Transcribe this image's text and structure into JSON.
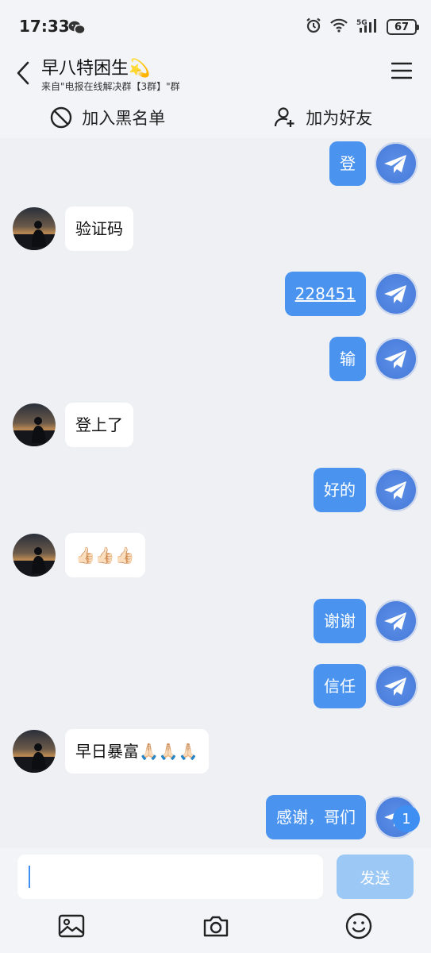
{
  "status_bar": {
    "time": "17:33",
    "battery": "67"
  },
  "header": {
    "title": "早八特困生💫",
    "subtitle": "来自\"电报在线解决群【3群】\"群"
  },
  "actions": {
    "blacklist": "加入黑名单",
    "add_friend": "加为好友"
  },
  "messages": [
    {
      "from": "me",
      "text": "登"
    },
    {
      "from": "other",
      "text": "验证码"
    },
    {
      "from": "me",
      "text": "228451",
      "link": true
    },
    {
      "from": "me",
      "text": "输"
    },
    {
      "from": "other",
      "text": "登上了"
    },
    {
      "from": "me",
      "text": "好的"
    },
    {
      "from": "other",
      "text": "👍🏻👍🏻👍🏻"
    },
    {
      "from": "me",
      "text": "谢谢"
    },
    {
      "from": "me",
      "text": "信任"
    },
    {
      "from": "other",
      "text": "早日暴富🙏🏻🙏🏻🙏🏻"
    },
    {
      "from": "me",
      "text": "感谢，哥们"
    }
  ],
  "unread_badge": "1",
  "input": {
    "placeholder": "",
    "send_label": "发送"
  },
  "bottom_icons": [
    "image-icon",
    "camera-icon",
    "emoji-icon"
  ],
  "colors": {
    "accent": "#4a94f0",
    "send_disabled": "#9cc8f5",
    "background": "#eef0f4"
  }
}
